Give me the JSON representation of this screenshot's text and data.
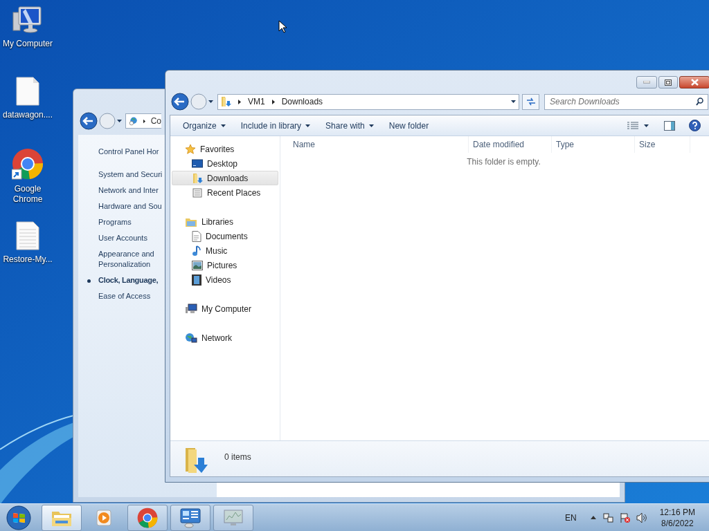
{
  "desktop_icons": [
    {
      "label": "My Computer",
      "kind": "computer"
    },
    {
      "label": "datawagon....",
      "kind": "blank"
    },
    {
      "label": "Google Chrome",
      "kind": "chrome"
    },
    {
      "label": "Restore-My...",
      "kind": "text"
    }
  ],
  "control_panel": {
    "address": "Co",
    "nav": [
      {
        "label": "Control Panel Hor",
        "selected": false
      },
      {
        "label": "System and Securi",
        "selected": false
      },
      {
        "label": "Network and Inter",
        "selected": false
      },
      {
        "label": "Hardware and Sou",
        "selected": false
      },
      {
        "label": "Programs",
        "selected": false
      },
      {
        "label": "User Accounts",
        "selected": false
      },
      {
        "label": "Appearance and Personalization",
        "selected": false
      },
      {
        "label": "Clock, Language,",
        "selected": true
      },
      {
        "label": "Ease of Access",
        "selected": false
      }
    ]
  },
  "explorer": {
    "breadcrumb": [
      "VM1",
      "Downloads"
    ],
    "search": {
      "placeholder": "Search Downloads"
    },
    "toolbar": [
      {
        "label": "Organize",
        "dropdown": true
      },
      {
        "label": "Include in library",
        "dropdown": true
      },
      {
        "label": "Share with",
        "dropdown": true
      },
      {
        "label": "New folder",
        "dropdown": false
      }
    ],
    "nav": [
      {
        "label": "Favorites",
        "kind": "star",
        "children": [
          {
            "label": "Desktop",
            "kind": "desktop",
            "selected": false
          },
          {
            "label": "Downloads",
            "kind": "downloads",
            "selected": true
          },
          {
            "label": "Recent Places",
            "kind": "recent",
            "selected": false
          }
        ]
      },
      {
        "label": "Libraries",
        "kind": "library",
        "children": [
          {
            "label": "Documents",
            "kind": "document",
            "selected": false
          },
          {
            "label": "Music",
            "kind": "music",
            "selected": false
          },
          {
            "label": "Pictures",
            "kind": "pictures",
            "selected": false
          },
          {
            "label": "Videos",
            "kind": "videos",
            "selected": false
          }
        ]
      },
      {
        "label": "My Computer",
        "kind": "computer"
      },
      {
        "label": "Network",
        "kind": "network"
      }
    ],
    "columns": [
      "Name",
      "Date modified",
      "Type",
      "Size"
    ],
    "empty_message": "This folder is empty.",
    "status": "0 items"
  },
  "taskbar": {
    "items": [
      {
        "kind": "explorer",
        "selected": true,
        "running": true
      },
      {
        "kind": "media",
        "selected": false,
        "running": false
      },
      {
        "kind": "chrome",
        "selected": false,
        "running": true
      },
      {
        "kind": "controlpanel",
        "selected": false,
        "running": true
      },
      {
        "kind": "monitor",
        "selected": false,
        "running": true
      }
    ],
    "language": "EN",
    "time": "12:16 PM",
    "date": "8/6/2022"
  }
}
